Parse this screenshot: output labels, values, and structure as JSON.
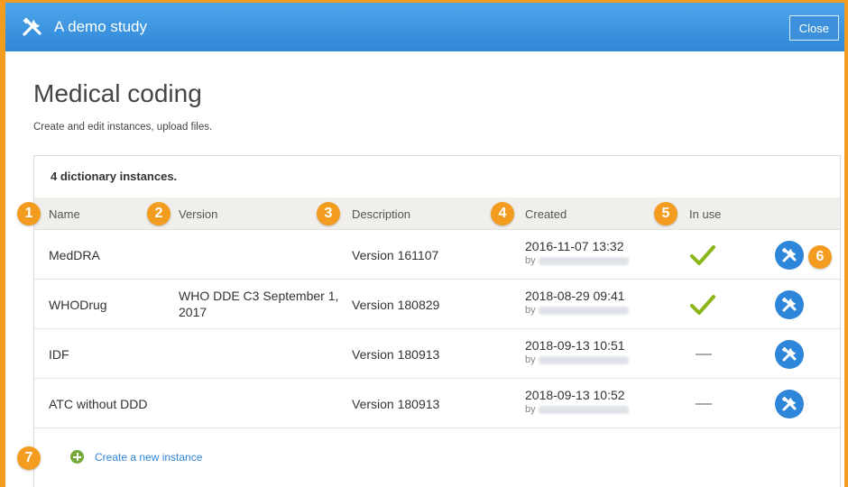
{
  "window": {
    "title": "A demo study",
    "close_label": "Close"
  },
  "page": {
    "title": "Medical coding",
    "subtitle": "Create and edit instances, upload files."
  },
  "summary": "4 dictionary instances.",
  "columns": {
    "name": "Name",
    "version": "Version",
    "description": "Description",
    "created": "Created",
    "in_use": "In use"
  },
  "rows": [
    {
      "name": "MedDRA",
      "version": "",
      "description": "Version 161107",
      "created": "2016-11-07 13:32",
      "by": "by",
      "in_use": true
    },
    {
      "name": "WHODrug",
      "version": "WHO DDE C3 September 1, 2017",
      "description": "Version 180829",
      "created": "2018-08-29 09:41",
      "by": "by",
      "in_use": true
    },
    {
      "name": "IDF",
      "version": "",
      "description": "Version 180913",
      "created": "2018-09-13 10:51",
      "by": "by",
      "in_use": false
    },
    {
      "name": "ATC without DDD",
      "version": "",
      "description": "Version 180913",
      "created": "2018-09-13 10:52",
      "by": "by",
      "in_use": false
    }
  ],
  "create_link": "Create a new instance",
  "markers": [
    "1",
    "2",
    "3",
    "4",
    "5",
    "6",
    "7"
  ],
  "icons": {
    "title": "tools-icon",
    "in_use_yes": "checkmark-icon",
    "in_use_no": "dash-icon",
    "action": "tools-icon",
    "create": "plus-circle-icon"
  },
  "colors": {
    "accent": "#2d86d9",
    "marker": "#f39c1f",
    "check": "#8bb617",
    "plus": "#75a93a"
  }
}
